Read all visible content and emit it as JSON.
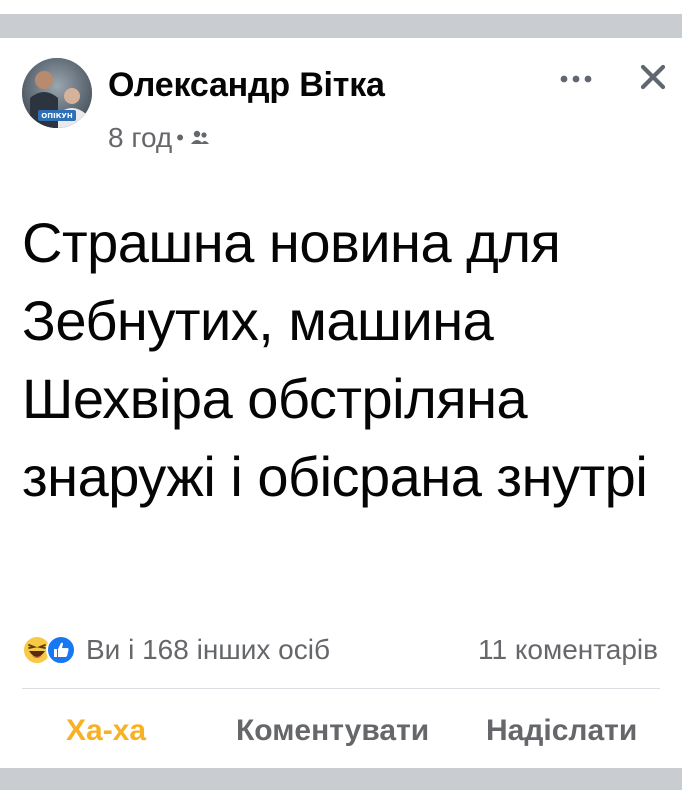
{
  "post": {
    "author": "Олександр Вітка",
    "time": "8 год",
    "separator": "•",
    "audience_icon": "friends-icon",
    "avatar_badge": "ОПІКУН",
    "text": "Страшна новина для Зебнутих, машина Шехвіра обстріляна знаружі і обісрана знутрі",
    "reactions": {
      "icons": [
        "haha-emoji",
        "like-emoji"
      ],
      "summary": "Ви і 168 інших осіб",
      "comments": "11 коментарів"
    },
    "actions": {
      "haha": "Ха-ха",
      "comment": "Коментувати",
      "share": "Надіслати"
    }
  },
  "colors": {
    "haha_active": "#f7b125",
    "secondary_text": "#65676b",
    "primary_text": "#050505",
    "like_blue": "#1877f2",
    "feed_gray": "#c9ccd1"
  }
}
